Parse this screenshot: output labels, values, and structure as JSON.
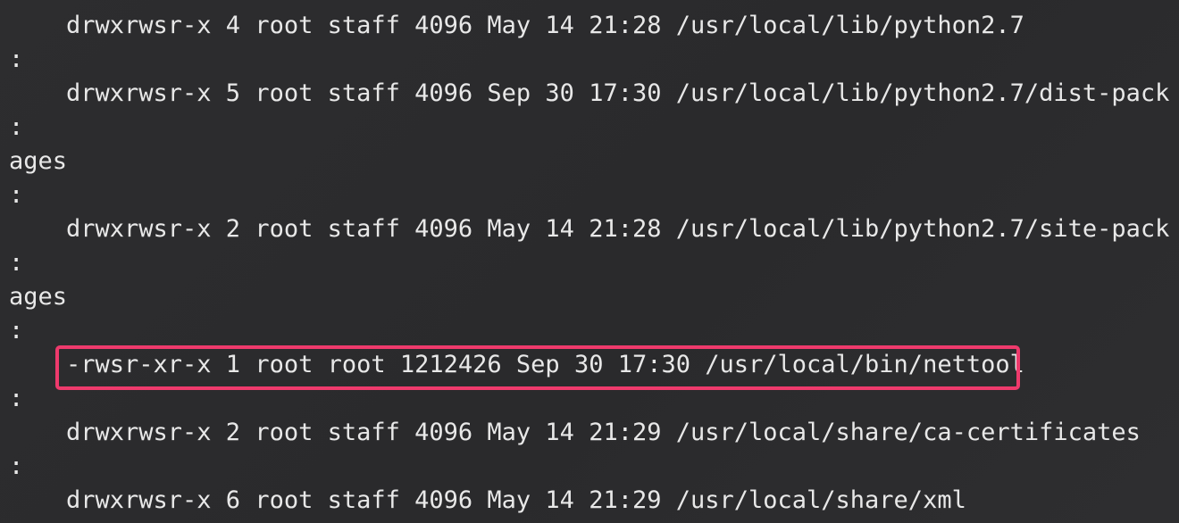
{
  "terminal": {
    "highlight_color": "#ee3a6c",
    "lines": [
      {
        "kind": "entry",
        "text": "drwxrwsr-x 4 root staff 4096 May 14 21:28 /usr/local/lib/python2.7"
      },
      {
        "kind": "sep",
        "text": ":"
      },
      {
        "kind": "entry",
        "text": "drwxrwsr-x 5 root staff 4096 Sep 30 17:30 /usr/local/lib/python2.7/dist-pack"
      },
      {
        "kind": "sep",
        "text": ":"
      },
      {
        "kind": "cont",
        "text": "ages"
      },
      {
        "kind": "sep",
        "text": ":"
      },
      {
        "kind": "entry",
        "text": "drwxrwsr-x 2 root staff 4096 May 14 21:28 /usr/local/lib/python2.7/site-pack"
      },
      {
        "kind": "sep",
        "text": ":"
      },
      {
        "kind": "cont",
        "text": "ages"
      },
      {
        "kind": "sep",
        "text": ":"
      },
      {
        "kind": "entry",
        "text": "-rwsr-xr-x 1 root root 1212426 Sep 30 17:30 /usr/local/bin/nettool",
        "highlighted": true
      },
      {
        "kind": "sep",
        "text": ":"
      },
      {
        "kind": "entry",
        "text": "drwxrwsr-x 2 root staff 4096 May 14 21:29 /usr/local/share/ca-certificates"
      },
      {
        "kind": "sep",
        "text": ":"
      },
      {
        "kind": "entry",
        "text": "drwxrwsr-x 6 root staff 4096 May 14 21:29 /usr/local/share/xml"
      }
    ]
  }
}
